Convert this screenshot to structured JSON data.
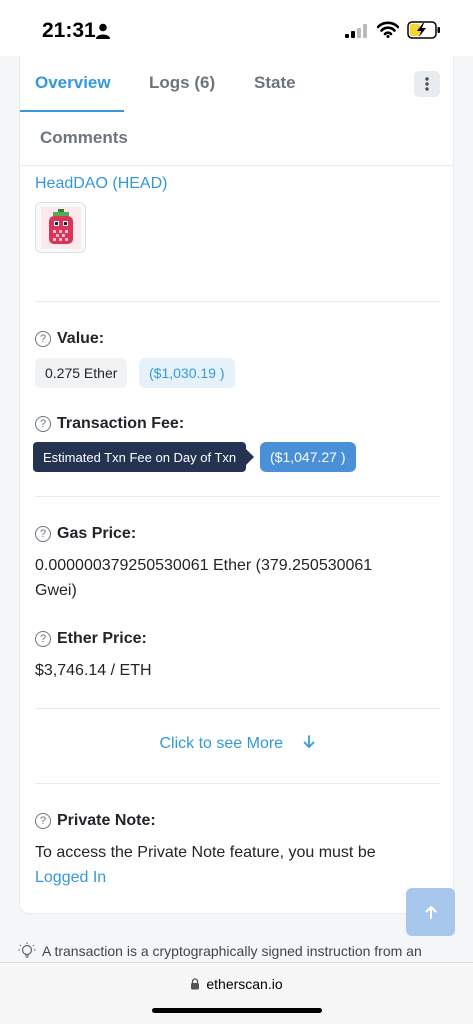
{
  "status_bar": {
    "time": "21:31"
  },
  "tabs": [
    {
      "label": "Overview"
    },
    {
      "label": "Logs (6)"
    },
    {
      "label": "State"
    },
    {
      "label": "Comments"
    }
  ],
  "token": {
    "name": "HeadDAO (HEAD)"
  },
  "value": {
    "label": "Value:",
    "amount": "0.275 Ether",
    "usd": "($1,030.19 )"
  },
  "fee": {
    "label": "Transaction Fee:",
    "tooltip": "Estimated Txn Fee on Day of Txn",
    "usd": "($1,047.27 )"
  },
  "gas": {
    "label": "Gas Price:",
    "value": "0.000000379250530061 Ether (379.250530061 Gwei)"
  },
  "ether_price": {
    "label": "Ether Price:",
    "value": "$3,746.14 / ETH"
  },
  "see_more": {
    "label": "Click to see More",
    "icon": "arrow-down-icon"
  },
  "private_note": {
    "label": "Private Note:",
    "text": "To access the Private Note feature, you must be",
    "link": "Logged In"
  },
  "footer": {
    "note": "A transaction is a cryptographically signed instruction from an",
    "url": "etherscan.io"
  },
  "colors": {
    "accent": "#3498db",
    "tooltip_bg": "#253353",
    "badge_blue": "#4a90d9"
  }
}
